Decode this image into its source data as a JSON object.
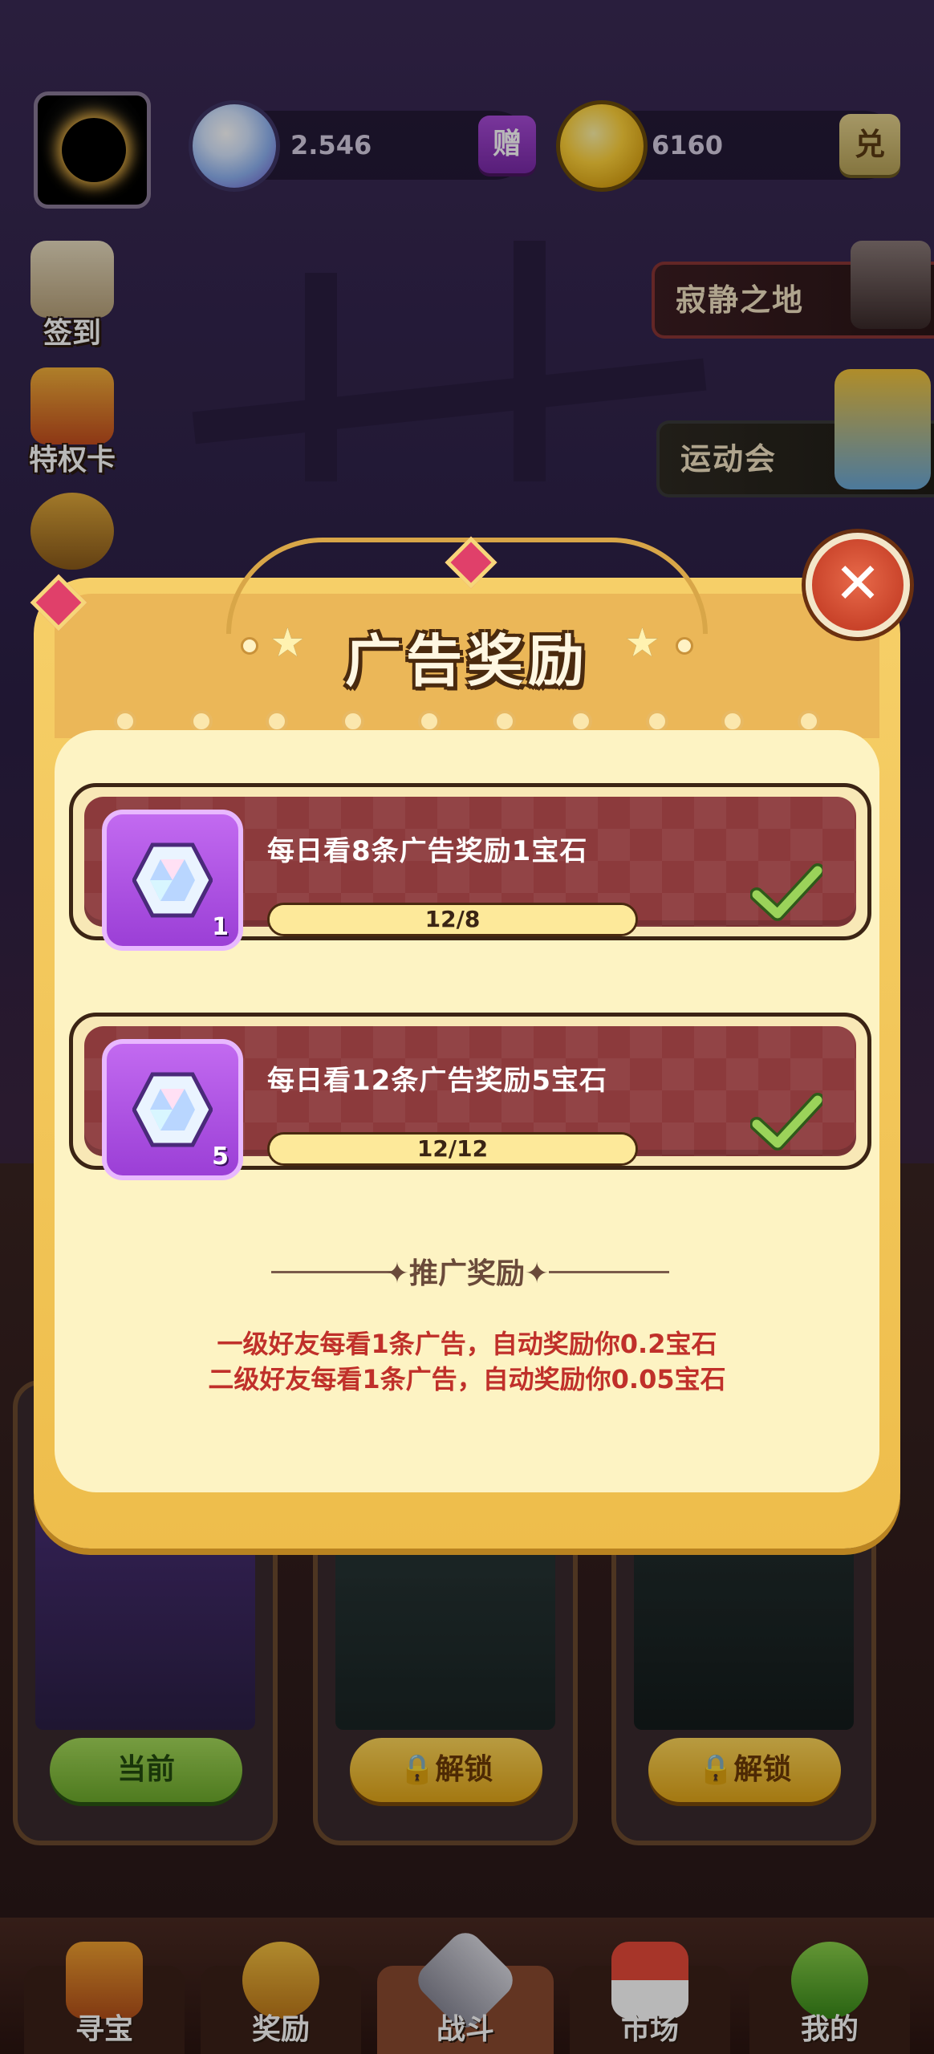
{
  "header": {
    "gems_value": "2.546",
    "give_label": "赠",
    "coins_value": "6160",
    "exchange_label": "兑"
  },
  "side_menu": [
    {
      "label": "签到",
      "icon": "scroll-icon"
    },
    {
      "label": "特权卡",
      "icon": "privilege-card-icon"
    },
    {
      "label": "",
      "icon": "handshake-icon"
    }
  ],
  "right_banners": [
    {
      "label": "寂静之地",
      "icon": "silent-land-icon"
    },
    {
      "label": "运动会",
      "icon": "sports-meet-icon"
    }
  ],
  "modal": {
    "title": "广告奖励",
    "close_icon": "close-icon",
    "rewards": [
      {
        "text": "每日看8条广告奖励1宝石",
        "gem_count": "1",
        "progress_text": "12/8",
        "progress": 1.0,
        "completed": true
      },
      {
        "text": "每日看12条广告奖励5宝石",
        "gem_count": "5",
        "progress_text": "12/12",
        "progress": 1.0,
        "completed": true
      }
    ],
    "promo_title": "推广奖励",
    "promo_lines": [
      "一级好友每看1条广告，自动奖励你0.2宝石",
      "二级好友每看1条广告，自动奖励你0.05宝石"
    ]
  },
  "cards": [
    {
      "button": "当前",
      "style": "current"
    },
    {
      "button": "解锁",
      "style": "locked"
    },
    {
      "button": "解锁",
      "style": "locked"
    }
  ],
  "nav": [
    {
      "label": "寻宝",
      "icon": "treasure-chest-icon",
      "active": false
    },
    {
      "label": "奖励",
      "icon": "reward-bag-icon",
      "active": false
    },
    {
      "label": "战斗",
      "icon": "crossed-swords-icon",
      "active": true
    },
    {
      "label": "市场",
      "icon": "market-stall-icon",
      "active": false
    },
    {
      "label": "我的",
      "icon": "profile-icon",
      "active": false
    }
  ],
  "colors": {
    "modal_bg": "#fdf3c3",
    "row_bg": "#8c3a3c",
    "check": "#9bd35a",
    "promo_text": "#c0302a"
  }
}
